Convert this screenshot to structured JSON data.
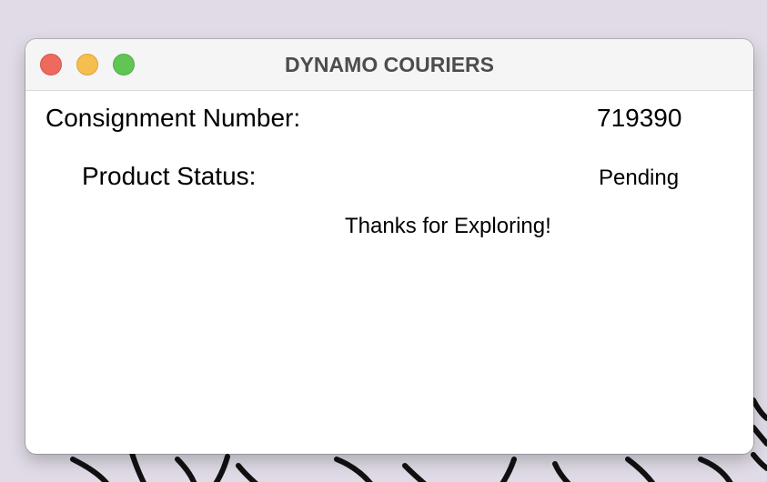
{
  "window": {
    "title": "DYNAMO COURIERS"
  },
  "traffic_lights": {
    "close_color": "#ee6a5e",
    "minimize_color": "#f5bf4f",
    "maximize_color": "#61c554"
  },
  "consignment": {
    "label": "Consignment Number:",
    "value": "719390"
  },
  "status": {
    "label": "Product Status:",
    "value": "Pending"
  },
  "message": "Thanks for Exploring!",
  "colors": {
    "desktop_background": "#e0dbe6",
    "titlebar": "#f5f5f5",
    "title_text": "#4d4d4d"
  }
}
